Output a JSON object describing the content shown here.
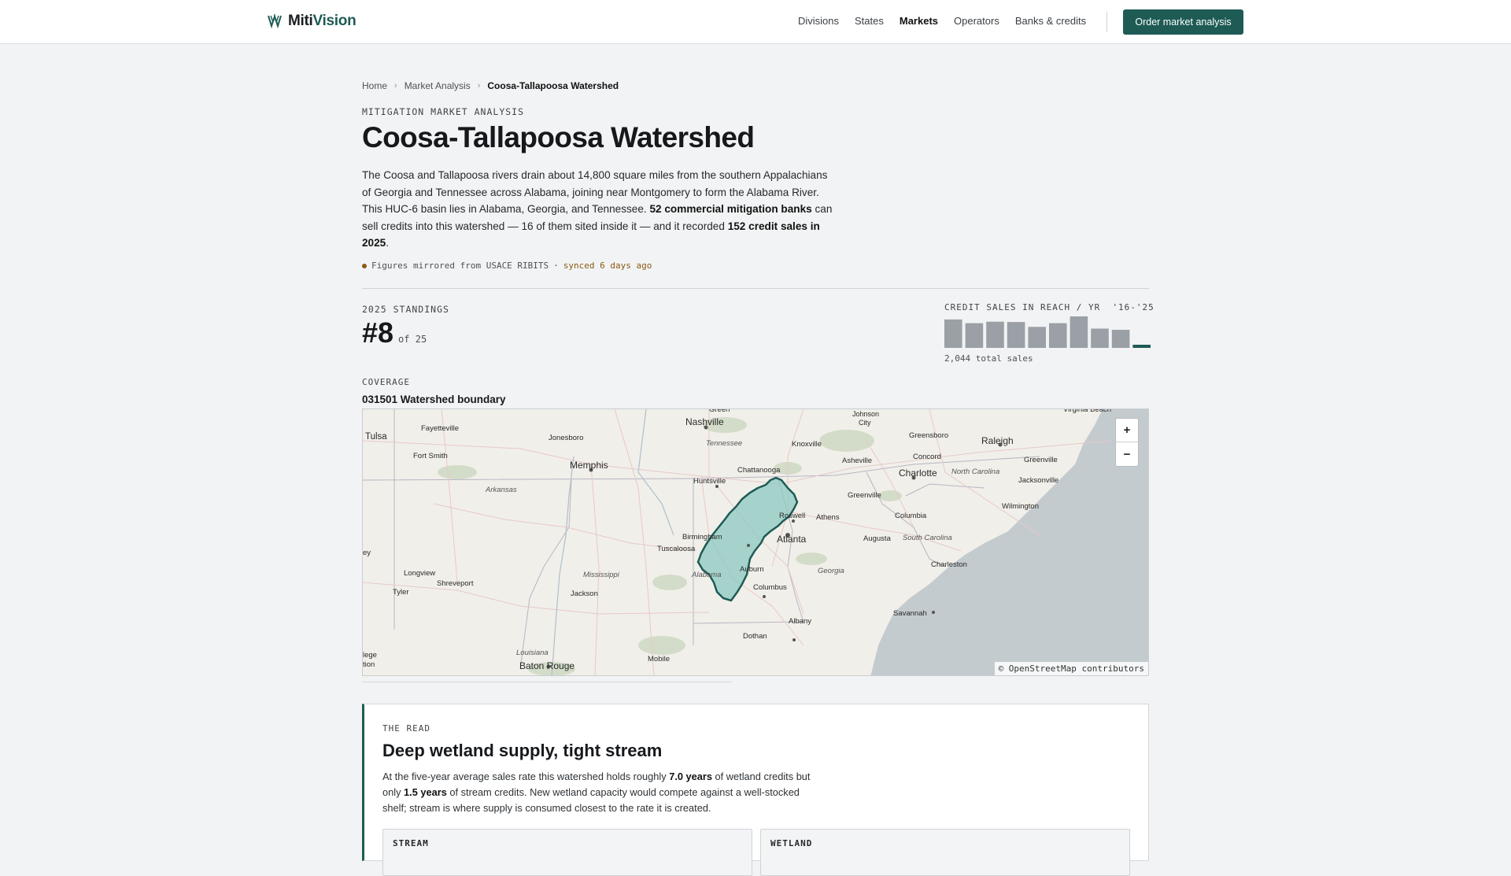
{
  "brand": {
    "name_part1": "Miti",
    "name_part2": "Vision"
  },
  "nav": {
    "links": [
      "Divisions",
      "States",
      "Markets",
      "Operators",
      "Banks & credits"
    ],
    "active": "Markets",
    "cta": "Order market analysis"
  },
  "breadcrumb": {
    "home": "Home",
    "section": "Market Analysis",
    "current": "Coosa-Tallapoosa Watershed"
  },
  "page": {
    "eyebrow": "MITIGATION MARKET ANALYSIS",
    "title": "Coosa-Tallapoosa Watershed",
    "intro_1": "The Coosa and Tallapoosa rivers drain about 14,800 square miles from the southern Appalachians of Georgia and Tennessee across Alabama, joining near Montgomery to form the Alabama River. This HUC-6 basin lies in Alabama, Georgia, and Tennessee. ",
    "intro_banks": "52 commercial mitigation banks",
    "intro_2": " can sell credits into this watershed — 16 of them sited inside it — and it recorded ",
    "intro_sales": "152 credit sales in 2025",
    "intro_3": ".",
    "sync_source": "Figures mirrored from USACE RIBITS",
    "sync_dot": "·",
    "sync_age": "synced 6 days ago"
  },
  "standings": {
    "label": "2025 STANDINGS",
    "rank": "#8",
    "of": "of 25"
  },
  "sales": {
    "label": "CREDIT SALES IN REACH / YR",
    "range": "'16-'25",
    "total": "2,044 total sales",
    "accent": "#1e5b55",
    "bar_color": "#9aa0a6"
  },
  "chart_data": {
    "type": "bar",
    "categories": [
      "2016",
      "2017",
      "2018",
      "2019",
      "2020",
      "2021",
      "2022",
      "2023",
      "2024",
      "2025"
    ],
    "values": [
      238,
      207,
      220,
      217,
      176,
      207,
      264,
      162,
      152,
      24
    ],
    "highlight_index": 9
  },
  "coverage": {
    "label": "COVERAGE",
    "name": "031501 Watershed boundary"
  },
  "map": {
    "zoom_in": "+",
    "zoom_out": "−",
    "attribution": "© OpenStreetMap contributors",
    "watershed_fill": "#8cc8c2",
    "watershed_stroke": "#1e5b55",
    "labels": [
      {
        "text": "Nashville",
        "size": "big"
      },
      {
        "text": "Tulsa",
        "size": "big"
      },
      {
        "text": "Fayetteville",
        "size": "small"
      },
      {
        "text": "Jonesboro",
        "size": "small"
      },
      {
        "text": "Fort Smith",
        "size": "small"
      },
      {
        "text": "Memphis",
        "size": "big"
      },
      {
        "text": "Arkansas",
        "size": "italic"
      },
      {
        "text": "Tennessee",
        "size": "italic"
      },
      {
        "text": "Knoxville",
        "size": "small"
      },
      {
        "text": "Johnson City",
        "size": "small"
      },
      {
        "text": "Greensboro",
        "size": "small"
      },
      {
        "text": "Raleigh",
        "size": "big"
      },
      {
        "text": "Asheville",
        "size": "small"
      },
      {
        "text": "Concord",
        "size": "small"
      },
      {
        "text": "Charlotte",
        "size": "big"
      },
      {
        "text": "Greenville",
        "size": "small"
      },
      {
        "text": "North Carolina",
        "size": "italic"
      },
      {
        "text": "Jacksonville",
        "size": "small"
      },
      {
        "text": "Chattanooga",
        "size": "small"
      },
      {
        "text": "Huntsville",
        "size": "small"
      },
      {
        "text": "Greenville",
        "size": "small"
      },
      {
        "text": "Wilmington",
        "size": "small"
      },
      {
        "text": "Roswell",
        "size": "small"
      },
      {
        "text": "Athens",
        "size": "small"
      },
      {
        "text": "Columbia",
        "size": "small"
      },
      {
        "text": "Birmingham",
        "size": "small"
      },
      {
        "text": "Atlanta",
        "size": "big"
      },
      {
        "text": "Augusta",
        "size": "small"
      },
      {
        "text": "South Carolina",
        "size": "italic"
      },
      {
        "text": "Tuscaloosa",
        "size": "small"
      },
      {
        "text": "Charleston",
        "size": "small"
      },
      {
        "text": "Georgia",
        "size": "italic"
      },
      {
        "text": "Longview",
        "size": "small"
      },
      {
        "text": "Shreveport",
        "size": "small"
      },
      {
        "text": "Mississippi",
        "size": "italic"
      },
      {
        "text": "Alabama",
        "size": "italic"
      },
      {
        "text": "Auburn",
        "size": "small"
      },
      {
        "text": "Tyler",
        "size": "small"
      },
      {
        "text": "Jackson",
        "size": "small"
      },
      {
        "text": "Columbus",
        "size": "small"
      },
      {
        "text": "Savannah",
        "size": "small"
      },
      {
        "text": "Albany",
        "size": "small"
      },
      {
        "text": "Dothan",
        "size": "small"
      },
      {
        "text": "Louisiana",
        "size": "italic"
      },
      {
        "text": "Baton Rouge",
        "size": "big"
      },
      {
        "text": "Mobile",
        "size": "small"
      },
      {
        "text": "Virginia Beach",
        "size": "small"
      },
      {
        "text": "Green",
        "size": "small"
      },
      {
        "text": "City",
        "size": "small"
      },
      {
        "text": "ey",
        "size": "small"
      },
      {
        "text": "lege",
        "size": "small"
      },
      {
        "text": "tion",
        "size": "small"
      }
    ]
  },
  "read": {
    "eyebrow": "THE READ",
    "title": "Deep wetland supply, tight stream",
    "p1": "At the five-year average sales rate this watershed holds roughly ",
    "wet_years": "7.0 years",
    "p2": " of wetland credits but only ",
    "stream_years": "1.5 years",
    "p3": " of stream credits. New wetland capacity would compete against a well-stocked shelf; stream is where supply is consumed closest to the rate it is created.",
    "box_stream": "STREAM",
    "box_wetland": "WETLAND"
  }
}
